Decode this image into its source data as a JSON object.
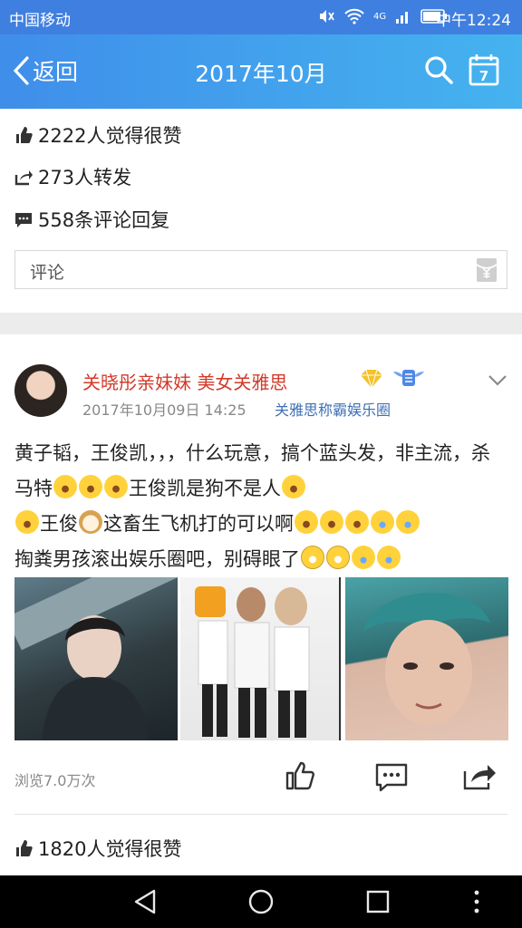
{
  "status_bar": {
    "carrier": "中国移动",
    "network": "4G",
    "time": "中午12:24"
  },
  "header": {
    "back_label": "返回",
    "title": "2017年10月",
    "calendar_day": "7"
  },
  "stats": {
    "likes": "2222人觉得很赞",
    "shares": "273人转发",
    "comments": "558条评论回复"
  },
  "comment_box": {
    "placeholder": "评论"
  },
  "post": {
    "username": "关晓彤亲妹妹 美女关雅思",
    "timestamp": "2017年10月09日 14:25",
    "source": "关雅思称霸娱乐圈",
    "body_segments": [
      "黄子韬，王俊凯，，，什么玩意，搞个蓝头发，非主流，杀马特",
      "王俊凯是狗不是人",
      "王俊",
      "这畜生飞机打的可以啊",
      "掏粪男孩滚出娱乐圈吧，别碍眼了"
    ],
    "views": "浏览7.0万次",
    "icons": [
      "like-icon",
      "comment-icon",
      "share-icon"
    ]
  },
  "next_post": {
    "likes": "1820人觉得很赞"
  },
  "colors": {
    "accent": "#3f8eea",
    "username": "#d23a2a",
    "source_link": "#3e6fb5"
  }
}
